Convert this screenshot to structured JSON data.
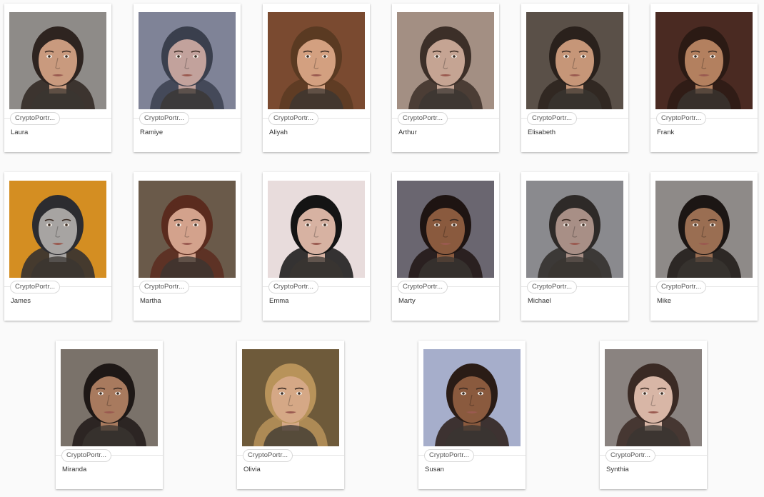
{
  "collection_label": "CryptoPortr...",
  "portraits": [
    {
      "name": "Laura",
      "bg": "#8e8b88",
      "skin": "#c99a7e",
      "hair": "#2e2420"
    },
    {
      "name": "Ramiye",
      "bg": "#7f8397",
      "skin": "#c2a29c",
      "hair": "#3a3f4d"
    },
    {
      "name": "Aliyah",
      "bg": "#7a4a30",
      "skin": "#d3a080",
      "hair": "#5a3a22"
    },
    {
      "name": "Arthur",
      "bg": "#a38f83",
      "skin": "#c5a493",
      "hair": "#3c2f28"
    },
    {
      "name": "Elisabeth",
      "bg": "#5a5048",
      "skin": "#c69678",
      "hair": "#2a211c"
    },
    {
      "name": "Frank",
      "bg": "#4a2a22",
      "skin": "#b3805f",
      "hair": "#2b1a14"
    },
    {
      "name": "James",
      "bg": "#d48e22",
      "skin": "#a7a4a2",
      "hair": "#2c2c30"
    },
    {
      "name": "Martha",
      "bg": "#6a5a4a",
      "skin": "#d3a28c",
      "hair": "#5a2b1e"
    },
    {
      "name": "Emma",
      "bg": "#e8dcdc",
      "skin": "#d7b2a2",
      "hair": "#141414"
    },
    {
      "name": "Marty",
      "bg": "#6a6670",
      "skin": "#8a5a3e",
      "hair": "#1e1412"
    },
    {
      "name": "Michael",
      "bg": "#8a8a8e",
      "skin": "#a88f86",
      "hair": "#2e2a28"
    },
    {
      "name": "Mike",
      "bg": "#8e8a88",
      "skin": "#9a6e52",
      "hair": "#1c1614"
    },
    {
      "name": "Miranda",
      "bg": "#7a726a",
      "skin": "#a87a5e",
      "hair": "#1e1816"
    },
    {
      "name": "Olivia",
      "bg": "#6e5a3a",
      "skin": "#d5a886",
      "hair": "#b8935a"
    },
    {
      "name": "Susan",
      "bg": "#a6aecb",
      "skin": "#8a5a3e",
      "hair": "#2a1c16"
    },
    {
      "name": "Synthia",
      "bg": "#8a8380",
      "skin": "#d8b6a6",
      "hair": "#3a2a24"
    }
  ]
}
